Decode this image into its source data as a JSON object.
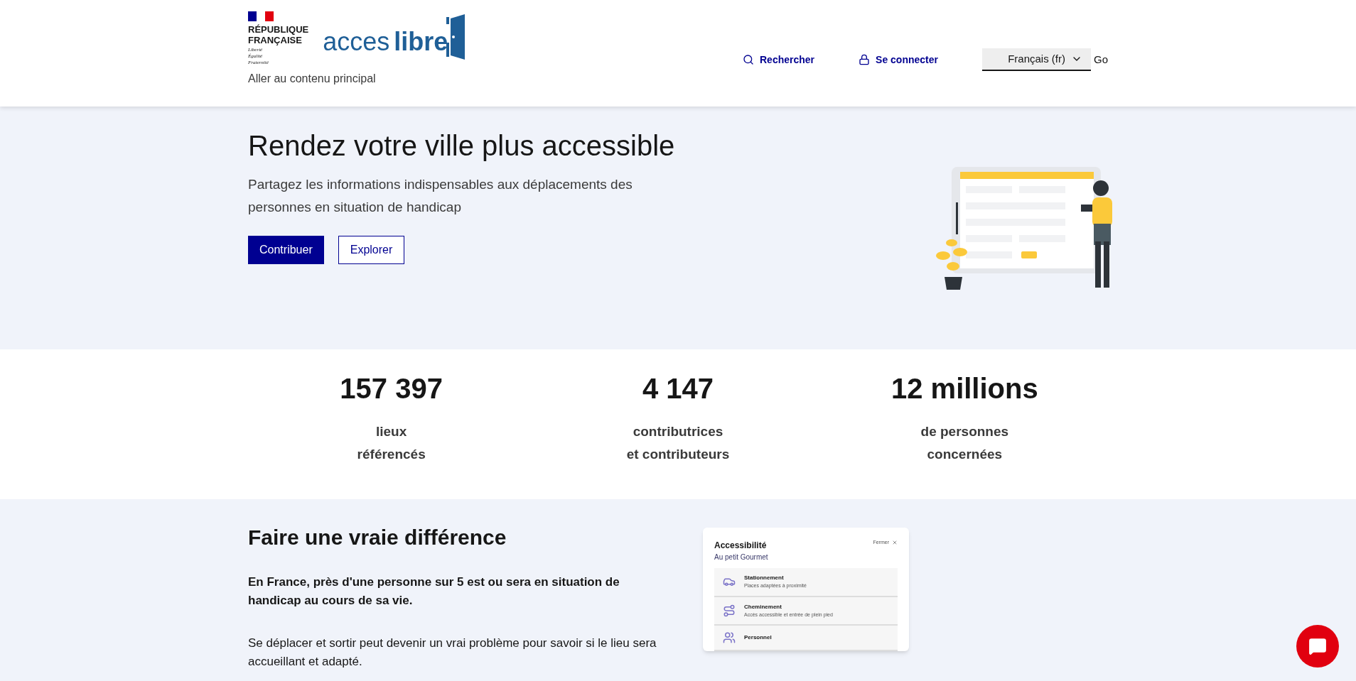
{
  "header": {
    "gov_logo": {
      "lines": [
        "RÉPUBLIQUE",
        "FRANÇAISE"
      ],
      "motto": [
        "Liberté",
        "Égalité",
        "Fraternité"
      ]
    },
    "site_logo": {
      "part1": "acces",
      "part2": "libre"
    },
    "skip_link": "Aller au contenu principal",
    "nav": [
      {
        "kind": "search",
        "label": "Rechercher"
      },
      {
        "kind": "lock",
        "label": "Se connecter"
      }
    ],
    "language": {
      "value": "Français (fr)",
      "button": "Go"
    }
  },
  "hero": {
    "title": "Rendez votre ville plus accessible",
    "text": "Partagez les informations indispensables aux déplacements des personnes en situation de handicap",
    "buttons": [
      {
        "label": "Contribuer",
        "kind": "primary"
      },
      {
        "label": "Explorer",
        "kind": "secondary"
      }
    ]
  },
  "stats": [
    {
      "value": "157 397",
      "label": [
        "lieux",
        "référencés"
      ]
    },
    {
      "value": "4 147",
      "label": [
        "contributrices",
        "et contributeurs"
      ]
    },
    {
      "value": "12 millions",
      "label": [
        "de personnes",
        "concernées"
      ]
    }
  ],
  "difference": {
    "title": "Faire une vraie différence",
    "paragraphs": [
      {
        "text": "En France, près d'une personne sur 5 est ou sera en situation de handicap au cours de sa vie.",
        "bold": true
      },
      {
        "text": "Se déplacer et sortir peut devenir un vrai problème pour savoir si le lieu sera accueillant et adapté.",
        "bold": false
      }
    ],
    "card": {
      "title": "Accessibilité",
      "subtitle": "Au petit Gourmet",
      "close": "Fermer",
      "items": [
        {
          "kind": "car",
          "title": "Stationnement",
          "text": "Places adaptées à proximité"
        },
        {
          "kind": "path",
          "title": "Cheminement",
          "text": "Accès accessible et entrée de plein pied"
        },
        {
          "kind": "people",
          "title": "Personnel"
        }
      ]
    }
  }
}
